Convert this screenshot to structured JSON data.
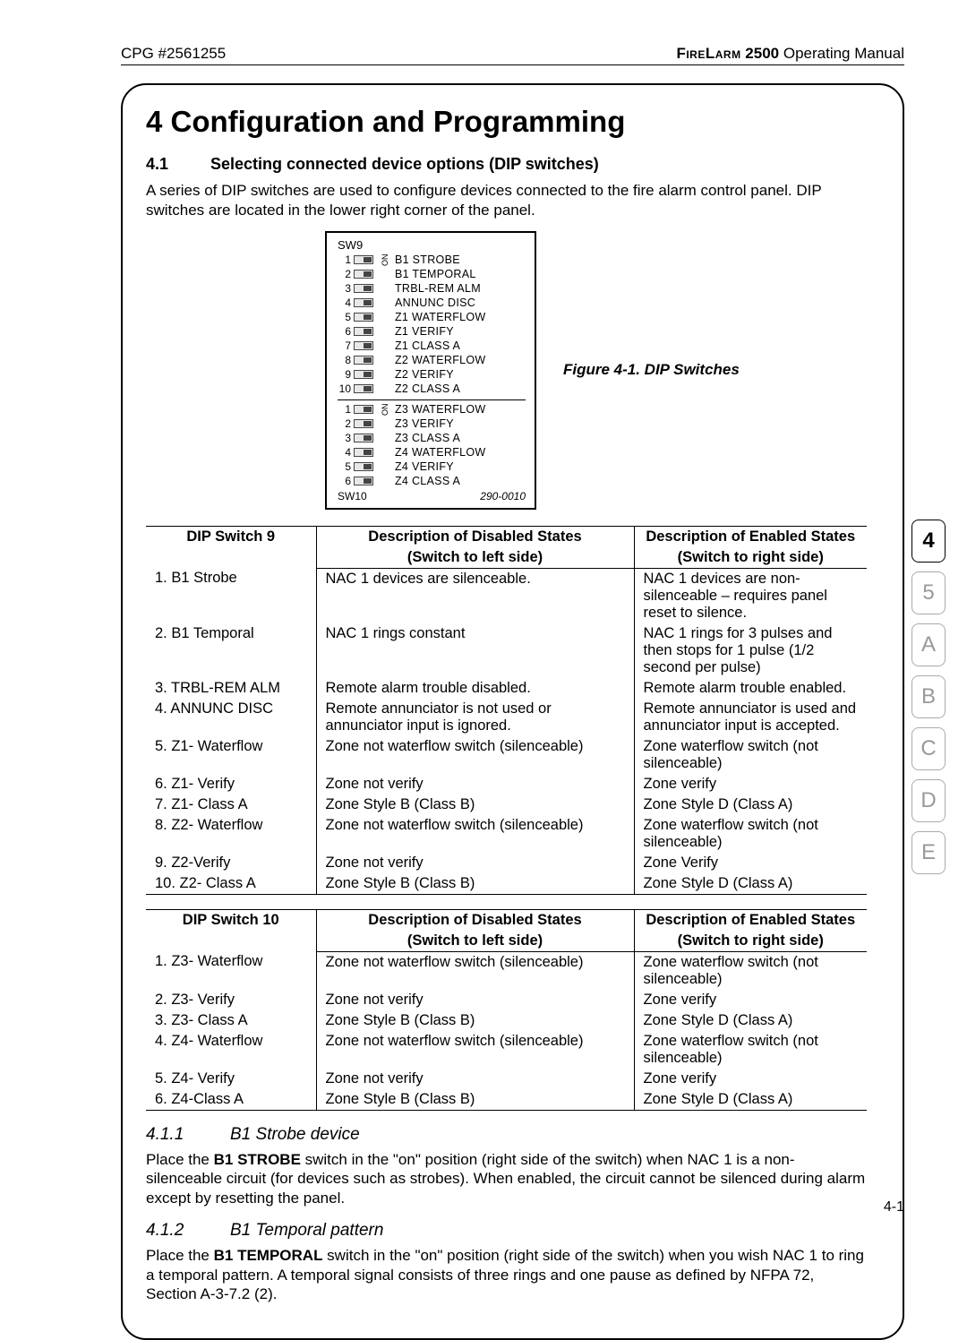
{
  "header": {
    "left": "CPG #2561255",
    "right_smallcaps": "FireLarm",
    "right_bold": " 2500",
    "right_rest": " Operating Manual"
  },
  "chapter_title": "4 Configuration and Programming",
  "section_4_1": {
    "num": "4.1",
    "title": "Selecting connected device options (DIP switches)",
    "para": "A series of DIP switches are used to configure devices connected to the fire alarm control panel. DIP switches are located in the lower right corner of the panel."
  },
  "figure": {
    "top_label": "SW9",
    "on_label": "ON",
    "block1": [
      {
        "n": "1",
        "label": "B1 STROBE"
      },
      {
        "n": "2",
        "label": "B1 TEMPORAL"
      },
      {
        "n": "3",
        "label": "TRBL-REM ALM"
      },
      {
        "n": "4",
        "label": "ANNUNC DISC"
      },
      {
        "n": "5",
        "label": "Z1 WATERFLOW"
      },
      {
        "n": "6",
        "label": "Z1 VERIFY"
      },
      {
        "n": "7",
        "label": "Z1 CLASS A"
      },
      {
        "n": "8",
        "label": "Z2 WATERFLOW"
      },
      {
        "n": "9",
        "label": "Z2 VERIFY"
      },
      {
        "n": "10",
        "label": "Z2 CLASS A"
      }
    ],
    "block2": [
      {
        "n": "1",
        "label": "Z3 WATERFLOW"
      },
      {
        "n": "2",
        "label": "Z3 VERIFY"
      },
      {
        "n": "3",
        "label": "Z3 CLASS A"
      },
      {
        "n": "4",
        "label": "Z4 WATERFLOW"
      },
      {
        "n": "5",
        "label": "Z4 VERIFY"
      },
      {
        "n": "6",
        "label": "Z4 CLASS A"
      }
    ],
    "bottom_label": "SW10",
    "bottom_code": "290-0010",
    "caption": "Figure 4-1. DIP Switches"
  },
  "table1": {
    "h1": "DIP Switch  9",
    "h2a": "Description of Disabled States",
    "h2b": "(Switch to left side)",
    "h3a": "Description of Enabled States",
    "h3b": "(Switch to right side)",
    "rows": [
      {
        "c1": "1.  B1 Strobe",
        "c2": "NAC 1 devices are silenceable.",
        "c3": "NAC 1 devices are non-silenceable – requires panel reset to silence."
      },
      {
        "c1": "2.  B1 Temporal",
        "c2": "NAC 1 rings constant",
        "c3": "NAC 1 rings for 3 pulses and then stops for 1 pulse (1/2 second per pulse)"
      },
      {
        "c1": "3.  TRBL-REM ALM",
        "c2": "Remote alarm trouble disabled.",
        "c3": "Remote alarm trouble enabled."
      },
      {
        "c1": "4.  ANNUNC DISC",
        "c2": "Remote annunciator is not used or annunciator input is ignored.",
        "c3": "Remote annunciator is used and annunciator input is accepted."
      },
      {
        "c1": "5.  Z1- Waterflow",
        "c2": "Zone not waterflow switch (silenceable)",
        "c3": "Zone waterflow switch (not silenceable)"
      },
      {
        "c1": "6.  Z1- Verify",
        "c2": "Zone not verify",
        "c3": "Zone verify"
      },
      {
        "c1": "7.  Z1- Class A",
        "c2": "Zone Style B (Class B)",
        "c3": "Zone Style D (Class A)"
      },
      {
        "c1": "8.  Z2- Waterflow",
        "c2": "Zone not waterflow switch (silenceable)",
        "c3": "Zone waterflow  switch (not silenceable)"
      },
      {
        "c1": "9.  Z2-Verify",
        "c2": "Zone not verify",
        "c3": "Zone Verify"
      },
      {
        "c1": "10. Z2- Class A",
        "c2": "Zone Style B (Class B)",
        "c3": "Zone Style D (Class A)"
      }
    ]
  },
  "table2": {
    "h1": "DIP Switch 10",
    "h2a": "Description of Disabled States",
    "h2b": "(Switch to left side)",
    "h3a": "Description of Enabled States",
    "h3b": "(Switch to right side)",
    "rows": [
      {
        "c1": "1. Z3- Waterflow",
        "c2": "Zone not waterflow switch (silenceable)",
        "c3": "Zone waterflow switch (not silenceable)"
      },
      {
        "c1": "2. Z3- Verify",
        "c2": "Zone not verify",
        "c3": "Zone verify"
      },
      {
        "c1": "3. Z3- Class A",
        "c2": "Zone Style B (Class B)",
        "c3": "Zone Style D (Class A)"
      },
      {
        "c1": "4. Z4- Waterflow",
        "c2": "Zone not waterflow switch (silenceable)",
        "c3": "Zone waterflow switch (not silenceable)"
      },
      {
        "c1": "5. Z4- Verify",
        "c2": "Zone not verify",
        "c3": "Zone verify"
      },
      {
        "c1": "6. Z4-Class A",
        "c2": "Zone Style B (Class B)",
        "c3": "Zone Style D (Class A)"
      }
    ]
  },
  "subsection_411": {
    "num": "4.1.1",
    "title": "B1 Strobe device",
    "para_pre": "Place the ",
    "para_bold": "B1 STROBE",
    "para_post": " switch in the \"on\" position (right side of the switch) when NAC 1 is a non-silenceable circuit (for devices such as strobes). When enabled, the circuit cannot be silenced during alarm except by resetting the panel."
  },
  "subsection_412": {
    "num": "4.1.2",
    "title": "B1 Temporal pattern",
    "para_pre": "Place the ",
    "para_bold": "B1 TEMPORAL",
    "para_post": " switch in the \"on\" position (right side of the switch) when you wish NAC 1 to ring a temporal pattern. A temporal signal consists of three rings and one pause as defined by NFPA 72, Section A-3-7.2 (2)."
  },
  "tabs": [
    "4",
    "5",
    "A",
    "B",
    "C",
    "D",
    "E"
  ],
  "active_tab": "4",
  "page_number": "4-1"
}
